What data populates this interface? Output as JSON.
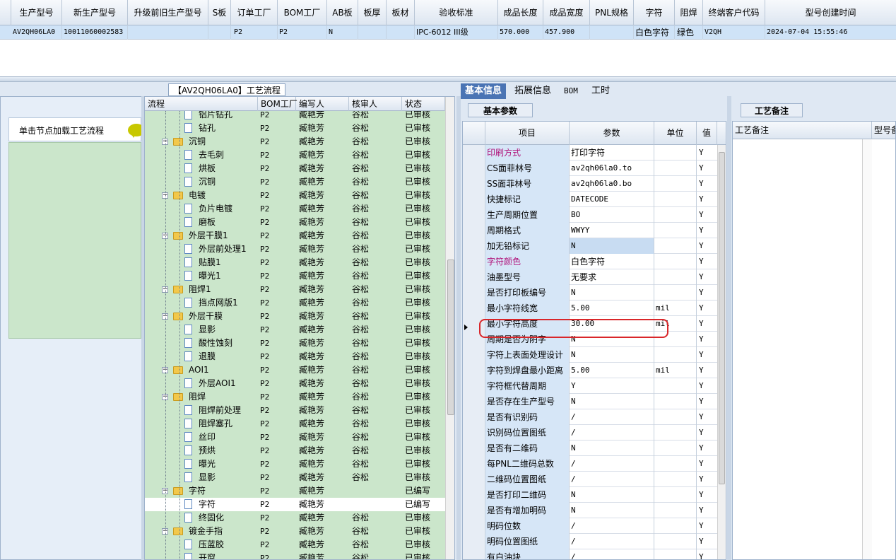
{
  "top_table": {
    "headers": [
      "生产型号",
      "新生产型号",
      "升级前旧生产型号",
      "S板",
      "订单工厂",
      "BOM工厂",
      "AB板",
      "板厚",
      "板材",
      "验收标准",
      "成品长度",
      "成品宽度",
      "PNL规格",
      "字符",
      "阻焊",
      "终端客户代码",
      "型号创建时间"
    ],
    "row": [
      "AV2QH06LA0",
      "10011060002583",
      "",
      "",
      "P2",
      "P2",
      "N",
      "",
      "",
      "IPC-6012 III级",
      "570.000",
      "457.900",
      "",
      "白色字符",
      "绿色",
      "V2QH",
      "2024-07-04 15:55:46"
    ]
  },
  "left_panel": {
    "hint": "单击节点加载工艺流程"
  },
  "flow": {
    "title": "【AV2QH06LA0】工艺流程",
    "headers": [
      "流程",
      "BOM工厂",
      "编写人",
      "核审人",
      "状态"
    ],
    "rows": [
      {
        "name": "铝片钻孔",
        "level": 2,
        "bom": "P2",
        "writer": "臧艳芳",
        "reviewer": "谷松",
        "status": "已审核"
      },
      {
        "name": "钻孔",
        "level": 2,
        "bom": "P2",
        "writer": "臧艳芳",
        "reviewer": "谷松",
        "status": "已审核"
      },
      {
        "name": "沉铜",
        "level": 1,
        "bom": "P2",
        "writer": "臧艳芳",
        "reviewer": "谷松",
        "status": "已审核"
      },
      {
        "name": "去毛刺",
        "level": 2,
        "bom": "P2",
        "writer": "臧艳芳",
        "reviewer": "谷松",
        "status": "已审核"
      },
      {
        "name": "烘板",
        "level": 2,
        "bom": "P2",
        "writer": "臧艳芳",
        "reviewer": "谷松",
        "status": "已审核"
      },
      {
        "name": "沉铜",
        "level": 2,
        "bom": "P2",
        "writer": "臧艳芳",
        "reviewer": "谷松",
        "status": "已审核"
      },
      {
        "name": "电镀",
        "level": 1,
        "bom": "P2",
        "writer": "臧艳芳",
        "reviewer": "谷松",
        "status": "已审核"
      },
      {
        "name": "负片电镀",
        "level": 2,
        "bom": "P2",
        "writer": "臧艳芳",
        "reviewer": "谷松",
        "status": "已审核"
      },
      {
        "name": "磨板",
        "level": 2,
        "bom": "P2",
        "writer": "臧艳芳",
        "reviewer": "谷松",
        "status": "已审核"
      },
      {
        "name": "外层干膜1",
        "level": 1,
        "bom": "P2",
        "writer": "臧艳芳",
        "reviewer": "谷松",
        "status": "已审核"
      },
      {
        "name": "外层前处理1",
        "level": 2,
        "bom": "P2",
        "writer": "臧艳芳",
        "reviewer": "谷松",
        "status": "已审核"
      },
      {
        "name": "贴膜1",
        "level": 2,
        "bom": "P2",
        "writer": "臧艳芳",
        "reviewer": "谷松",
        "status": "已审核"
      },
      {
        "name": "曝光1",
        "level": 2,
        "bom": "P2",
        "writer": "臧艳芳",
        "reviewer": "谷松",
        "status": "已审核"
      },
      {
        "name": "阻焊1",
        "level": 1,
        "bom": "P2",
        "writer": "臧艳芳",
        "reviewer": "谷松",
        "status": "已审核"
      },
      {
        "name": "挡点网版1",
        "level": 2,
        "bom": "P2",
        "writer": "臧艳芳",
        "reviewer": "谷松",
        "status": "已审核"
      },
      {
        "name": "外层干膜",
        "level": 1,
        "bom": "P2",
        "writer": "臧艳芳",
        "reviewer": "谷松",
        "status": "已审核"
      },
      {
        "name": "显影",
        "level": 2,
        "bom": "P2",
        "writer": "臧艳芳",
        "reviewer": "谷松",
        "status": "已审核"
      },
      {
        "name": "酸性蚀刻",
        "level": 2,
        "bom": "P2",
        "writer": "臧艳芳",
        "reviewer": "谷松",
        "status": "已审核"
      },
      {
        "name": "退膜",
        "level": 2,
        "bom": "P2",
        "writer": "臧艳芳",
        "reviewer": "谷松",
        "status": "已审核"
      },
      {
        "name": "AOI1",
        "level": 1,
        "bom": "P2",
        "writer": "臧艳芳",
        "reviewer": "谷松",
        "status": "已审核"
      },
      {
        "name": "外层AOI1",
        "level": 2,
        "bom": "P2",
        "writer": "臧艳芳",
        "reviewer": "谷松",
        "status": "已审核"
      },
      {
        "name": "阻焊",
        "level": 1,
        "bom": "P2",
        "writer": "臧艳芳",
        "reviewer": "谷松",
        "status": "已审核"
      },
      {
        "name": "阻焊前处理",
        "level": 2,
        "bom": "P2",
        "writer": "臧艳芳",
        "reviewer": "谷松",
        "status": "已审核"
      },
      {
        "name": "阻焊塞孔",
        "level": 2,
        "bom": "P2",
        "writer": "臧艳芳",
        "reviewer": "谷松",
        "status": "已审核"
      },
      {
        "name": "丝印",
        "level": 2,
        "bom": "P2",
        "writer": "臧艳芳",
        "reviewer": "谷松",
        "status": "已审核"
      },
      {
        "name": "预烘",
        "level": 2,
        "bom": "P2",
        "writer": "臧艳芳",
        "reviewer": "谷松",
        "status": "已审核"
      },
      {
        "name": "曝光",
        "level": 2,
        "bom": "P2",
        "writer": "臧艳芳",
        "reviewer": "谷松",
        "status": "已审核"
      },
      {
        "name": "显影",
        "level": 2,
        "bom": "P2",
        "writer": "臧艳芳",
        "reviewer": "谷松",
        "status": "已审核"
      },
      {
        "name": "字符",
        "level": 1,
        "bom": "P2",
        "writer": "臧艳芳",
        "reviewer": "",
        "status": "已编写"
      },
      {
        "name": "字符",
        "level": 2,
        "bom": "P2",
        "writer": "臧艳芳",
        "reviewer": "",
        "status": "已编写",
        "selected": true
      },
      {
        "name": "终固化",
        "level": 2,
        "bom": "P2",
        "writer": "臧艳芳",
        "reviewer": "谷松",
        "status": "已审核"
      },
      {
        "name": "镀金手指",
        "level": 1,
        "bom": "P2",
        "writer": "臧艳芳",
        "reviewer": "谷松",
        "status": "已审核"
      },
      {
        "name": "压蓝胶",
        "level": 2,
        "bom": "P2",
        "writer": "臧艳芳",
        "reviewer": "谷松",
        "status": "已审核"
      },
      {
        "name": "开窗",
        "level": 2,
        "bom": "P2",
        "writer": "臧艳芳",
        "reviewer": "谷松",
        "status": "已审核"
      }
    ]
  },
  "tabs": [
    "基本信息",
    "拓展信息",
    "BOM",
    "工时"
  ],
  "basic_params": {
    "title": "基本参数",
    "headers": [
      "项目",
      "参数",
      "单位",
      "值"
    ],
    "rows": [
      {
        "name": "印刷方式",
        "value": "打印字符",
        "unit": "",
        "flag": "Y",
        "highlight": true
      },
      {
        "name": "CS面菲林号",
        "value": "av2qh06la0.to",
        "unit": "",
        "flag": "Y"
      },
      {
        "name": "SS面菲林号",
        "value": "av2qh06la0.bo",
        "unit": "",
        "flag": "Y"
      },
      {
        "name": "快捷标记",
        "value": "DATECODE",
        "unit": "",
        "flag": "Y"
      },
      {
        "name": "生产周期位置",
        "value": "BO",
        "unit": "",
        "flag": "Y"
      },
      {
        "name": "周期格式",
        "value": "WWYY",
        "unit": "",
        "flag": "Y"
      },
      {
        "name": "加无铅标记",
        "value": "N",
        "unit": "",
        "flag": "Y",
        "selected": true
      },
      {
        "name": "字符颜色",
        "value": "白色字符",
        "unit": "",
        "flag": "Y",
        "highlight": true
      },
      {
        "name": "油墨型号",
        "value": "无要求",
        "unit": "",
        "flag": "Y"
      },
      {
        "name": "是否打印板编号",
        "value": "N",
        "unit": "",
        "flag": "Y"
      },
      {
        "name": "最小字符线宽",
        "value": "5.00",
        "unit": "mil",
        "flag": "Y"
      },
      {
        "name": "最小字符高度",
        "value": "30.00",
        "unit": "mil",
        "flag": "Y"
      },
      {
        "name": "周期是否为阴字",
        "value": "N",
        "unit": "",
        "flag": "Y"
      },
      {
        "name": "字符上表面处理设计",
        "value": "N",
        "unit": "",
        "flag": "Y"
      },
      {
        "name": "字符到焊盘最小距离",
        "value": "5.00",
        "unit": "mil",
        "flag": "Y"
      },
      {
        "name": "字符框代替周期",
        "value": "Y",
        "unit": "",
        "flag": "Y"
      },
      {
        "name": "是否存在生产型号",
        "value": "N",
        "unit": "",
        "flag": "Y"
      },
      {
        "name": "是否有识别码",
        "value": "/",
        "unit": "",
        "flag": "Y"
      },
      {
        "name": "识别码位置图纸",
        "value": "/",
        "unit": "",
        "flag": "Y"
      },
      {
        "name": "是否有二维码",
        "value": "N",
        "unit": "",
        "flag": "Y"
      },
      {
        "name": "每PNL二维码总数",
        "value": "/",
        "unit": "",
        "flag": "Y"
      },
      {
        "name": "二维码位置图纸",
        "value": "/",
        "unit": "",
        "flag": "Y"
      },
      {
        "name": "是否打印二维码",
        "value": "N",
        "unit": "",
        "flag": "Y"
      },
      {
        "name": "是否有增加明码",
        "value": "N",
        "unit": "",
        "flag": "Y"
      },
      {
        "name": "明码位数",
        "value": "/",
        "unit": "",
        "flag": "Y"
      },
      {
        "name": "明码位置图纸",
        "value": "/",
        "unit": "",
        "flag": "Y"
      },
      {
        "name": "有白油块",
        "value": "/",
        "unit": "",
        "flag": "Y"
      }
    ]
  },
  "remarks": {
    "title": "工艺备注",
    "headers": [
      "工艺备注",
      "型号备"
    ]
  }
}
